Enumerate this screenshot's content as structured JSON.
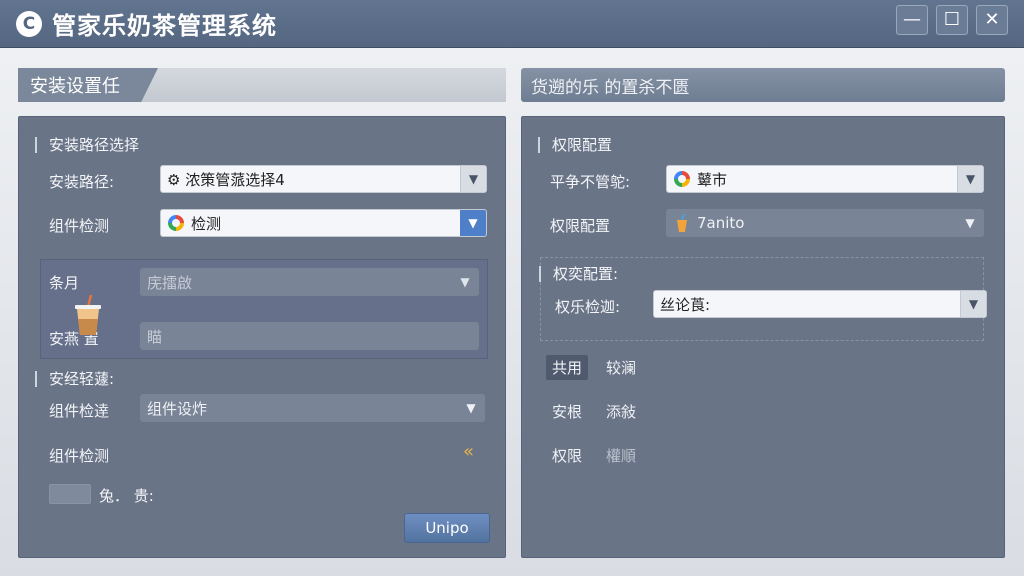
{
  "window": {
    "title": "管家乐奶茶管理系统",
    "logo_letter": "C",
    "minimize": "—",
    "maximize": "☐",
    "close": "✕"
  },
  "left": {
    "header": "安装设置任",
    "sec1": "安装路径选择",
    "path_label": "安装路径:",
    "path_value": "⚙ 浓策管蒎选择4",
    "component_label": "组件检测",
    "component_value": "检测",
    "sub_month_label": "条月",
    "sub_month_value": "庑擂啟",
    "sub_install_label": "安燕 置",
    "sub_install_value": "瞄",
    "sec2": "安经轻蘧:",
    "comp2_label": "组件检逹",
    "comp2_value": "组件设炸",
    "comp3_label": "组件检测",
    "comp3_icon": "«",
    "check_label": "兔．  贵:",
    "button": "Unipo"
  },
  "right": {
    "header": "货遡的乐 的置杀不匮",
    "sec1": "权限配置",
    "r1_label": "平争不管鸵:",
    "r1_value": "鼙市",
    "r2_label": "权限配置",
    "r2_value": "7anito",
    "sec2": "权奕配置:",
    "r3_label": "权乐检迦:",
    "r3_value": "丝论莨:",
    "tabs": [
      {
        "label": "共用",
        "active": true
      },
      {
        "label": "较澜",
        "active": false
      }
    ],
    "row2": [
      "安根",
      "添敍"
    ],
    "row3": [
      "权限",
      "權順"
    ]
  },
  "colors": {
    "titlebar": "#5a6c86",
    "panel": "#6a7487",
    "accent": "#4f7fc8"
  }
}
